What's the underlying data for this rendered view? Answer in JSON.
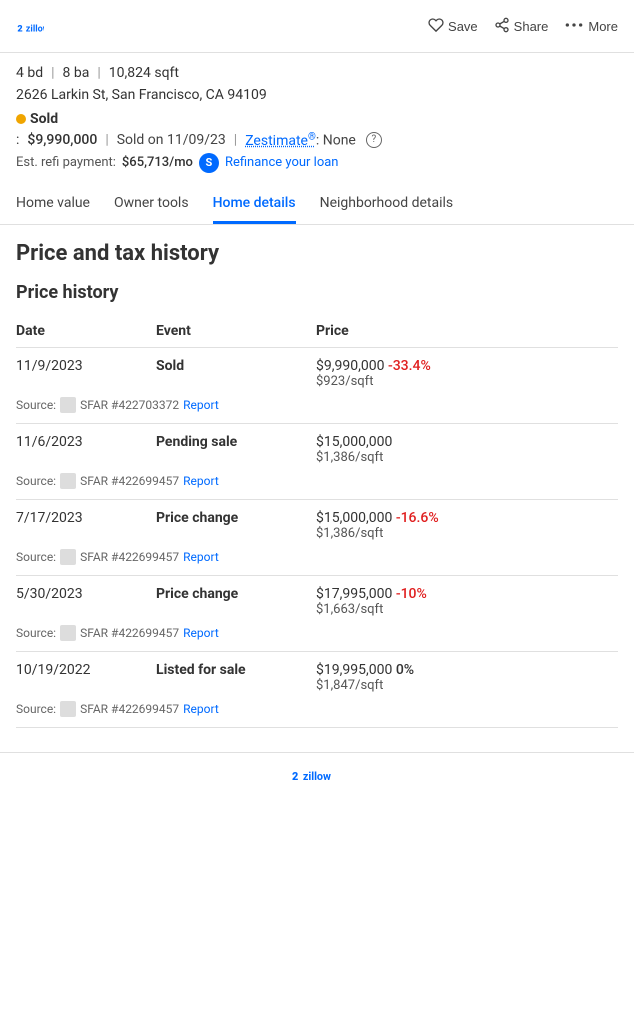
{
  "header": {
    "logo_text": "2 Zillow",
    "actions": [
      {
        "id": "save",
        "label": "Save",
        "icon": "heart"
      },
      {
        "id": "share",
        "label": "Share",
        "icon": "share"
      },
      {
        "id": "more",
        "label": "More",
        "icon": "dots"
      }
    ]
  },
  "property": {
    "beds": "4 bd",
    "baths": "8 ba",
    "sqft": "10,824 sqft",
    "address": "2626 Larkin St, San Francisco, CA 94109",
    "status": "Sold",
    "price": "$9,990,000",
    "sold_date": "Sold on 11/09/23",
    "zestimate_label": "Zestimate",
    "zestimate_super": "®",
    "zestimate_value": "None",
    "refi_label": "Est. refi payment:",
    "refi_amount": "$65,713/mo",
    "refi_link": "Refinance your loan",
    "refi_badge": "S"
  },
  "tabs": [
    {
      "id": "home-value",
      "label": "Home value",
      "active": false
    },
    {
      "id": "owner-tools",
      "label": "Owner tools",
      "active": false
    },
    {
      "id": "home-details",
      "label": "Home details",
      "active": true
    },
    {
      "id": "neighborhood-details",
      "label": "Neighborhood details",
      "active": false
    }
  ],
  "page_title": "Price and tax history",
  "price_history": {
    "title": "Price history",
    "columns": [
      "Date",
      "Event",
      "Price"
    ],
    "rows": [
      {
        "date": "11/9/2023",
        "event": "Sold",
        "price": "$9,990,000",
        "price_change": "-33.4%",
        "price_sqft": "$923/sqft",
        "source_text": "Source:",
        "source_icon": true,
        "source_id": "SFAR #422703372",
        "source_link": "Report"
      },
      {
        "date": "11/6/2023",
        "event": "Pending sale",
        "price": "$15,000,000",
        "price_change": "",
        "price_sqft": "$1,386/sqft",
        "source_text": "Source:",
        "source_icon": true,
        "source_id": "SFAR #422699457",
        "source_link": "Report"
      },
      {
        "date": "7/17/2023",
        "event": "Price change",
        "price": "$15,000,000",
        "price_change": "-16.6%",
        "price_sqft": "$1,386/sqft",
        "source_text": "Source:",
        "source_icon": true,
        "source_id": "SFAR #422699457",
        "source_link": "Report"
      },
      {
        "date": "5/30/2023",
        "event": "Price change",
        "price": "$17,995,000",
        "price_change": "-10%",
        "price_sqft": "$1,663/sqft",
        "source_text": "Source:",
        "source_icon": true,
        "source_id": "SFAR #422699457",
        "source_link": "Report"
      },
      {
        "date": "10/19/2022",
        "event": "Listed for sale",
        "price": "$19,995,000",
        "price_change": "0%",
        "price_sqft": "$1,847/sqft",
        "source_text": "Source:",
        "source_icon": true,
        "source_id": "SFAR #422699457",
        "source_link": "Report"
      }
    ]
  },
  "footer": {
    "logo": "2 Zillow"
  }
}
